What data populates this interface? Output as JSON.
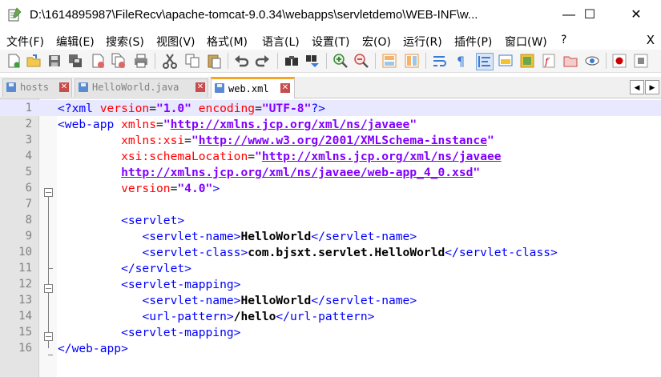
{
  "window": {
    "title": "D:\\1614895987\\FileRecv\\apache-tomcat-9.0.34\\webapps\\servletdemo\\WEB-INF\\w...",
    "minimize": "—",
    "maximize": "☐",
    "close": "✕"
  },
  "menu": {
    "items": [
      "文件(F)",
      "编辑(E)",
      "搜索(S)",
      "视图(V)",
      "格式(M)",
      "语言(L)",
      "设置(T)",
      "宏(O)",
      "运行(R)",
      "插件(P)",
      "窗口(W)",
      "?"
    ],
    "close": "X"
  },
  "toolbar": {
    "icons": [
      "new-file-icon",
      "open-file-icon",
      "save-icon",
      "save-all-icon",
      "close-icon",
      "close-all-icon",
      "print-icon",
      "cut-icon",
      "copy-icon",
      "paste-icon",
      "undo-icon",
      "redo-icon",
      "find-icon",
      "replace-icon",
      "zoom-in-icon",
      "zoom-out-icon",
      "sync-vertical-icon",
      "sync-horizontal-icon",
      "word-wrap-icon",
      "show-all-chars-icon",
      "indent-guide-icon",
      "lang-udl-icon",
      "doc-map-icon",
      "function-list-icon",
      "folder-workspace-icon",
      "monitor-icon",
      "record-macro-icon",
      "stop-macro-icon"
    ]
  },
  "tabs": [
    {
      "label": "hosts",
      "active": false
    },
    {
      "label": "HelloWorld.java",
      "active": false
    },
    {
      "label": "web.xml",
      "active": true
    }
  ],
  "tab_nav": {
    "left": "◀",
    "right": "▶"
  },
  "editor": {
    "lines": [
      {
        "n": "1",
        "tokens": [
          [
            "tag",
            "<?xml "
          ],
          [
            "attr",
            "version"
          ],
          [
            "plain",
            "="
          ],
          [
            "val",
            "\"1.0\""
          ],
          [
            "plain",
            " "
          ],
          [
            "attr",
            "encoding"
          ],
          [
            "plain",
            "="
          ],
          [
            "val",
            "\"UTF-8\""
          ],
          [
            "tag",
            "?>"
          ]
        ]
      },
      {
        "n": "2",
        "tokens": [
          [
            "tag",
            "<web-app "
          ],
          [
            "attr",
            "xmlns"
          ],
          [
            "plain",
            "="
          ],
          [
            "val",
            "\""
          ],
          [
            "url",
            "http://xmlns.jcp.org/xml/ns/javaee"
          ],
          [
            "val",
            "\""
          ]
        ]
      },
      {
        "n": "3",
        "tokens": [
          [
            "plain",
            "         "
          ],
          [
            "attr",
            "xmlns:xsi"
          ],
          [
            "plain",
            "="
          ],
          [
            "val",
            "\""
          ],
          [
            "url",
            "http://www.w3.org/2001/XMLSchema-instance"
          ],
          [
            "val",
            "\""
          ]
        ]
      },
      {
        "n": "4",
        "tokens": [
          [
            "plain",
            "         "
          ],
          [
            "attr",
            "xsi:schemaLocation"
          ],
          [
            "plain",
            "="
          ],
          [
            "val",
            "\""
          ],
          [
            "url",
            "http://xmlns.jcp.org/xml/ns/javaee"
          ]
        ]
      },
      {
        "n": "5",
        "tokens": [
          [
            "plain",
            "         "
          ],
          [
            "url",
            "http://xmlns.jcp.org/xml/ns/javaee/web-app_4_0.xsd"
          ],
          [
            "val",
            "\""
          ]
        ]
      },
      {
        "n": "6",
        "tokens": [
          [
            "plain",
            "         "
          ],
          [
            "attr",
            "version"
          ],
          [
            "plain",
            "="
          ],
          [
            "val",
            "\"4.0\""
          ],
          [
            "tag",
            ">"
          ]
        ]
      },
      {
        "n": "7",
        "tokens": []
      },
      {
        "n": "8",
        "tokens": [
          [
            "plain",
            "         "
          ],
          [
            "tag",
            "<servlet>"
          ]
        ]
      },
      {
        "n": "9",
        "tokens": [
          [
            "plain",
            "            "
          ],
          [
            "tag",
            "<servlet-name>"
          ],
          [
            "text",
            "HelloWorld"
          ],
          [
            "tag",
            "</servlet-name>"
          ]
        ]
      },
      {
        "n": "10",
        "tokens": [
          [
            "plain",
            "            "
          ],
          [
            "tag",
            "<servlet-class>"
          ],
          [
            "text",
            "com.bjsxt.servlet.HelloWorld"
          ],
          [
            "tag",
            "</servlet-class>"
          ]
        ]
      },
      {
        "n": "11",
        "tokens": [
          [
            "plain",
            "         "
          ],
          [
            "tag",
            "</servlet>"
          ]
        ]
      },
      {
        "n": "12",
        "tokens": [
          [
            "plain",
            "         "
          ],
          [
            "tag",
            "<servlet-mapping>"
          ]
        ]
      },
      {
        "n": "13",
        "tokens": [
          [
            "plain",
            "            "
          ],
          [
            "tag",
            "<servlet-name>"
          ],
          [
            "text",
            "HelloWorld"
          ],
          [
            "tag",
            "</servlet-name>"
          ]
        ]
      },
      {
        "n": "14",
        "tokens": [
          [
            "plain",
            "            "
          ],
          [
            "tag",
            "<url-pattern>"
          ],
          [
            "text",
            "/hello"
          ],
          [
            "tag",
            "</url-pattern>"
          ]
        ]
      },
      {
        "n": "15",
        "tokens": [
          [
            "plain",
            "         "
          ],
          [
            "tag",
            "<servlet-mapping>"
          ]
        ]
      },
      {
        "n": "16",
        "tokens": [
          [
            "tag",
            "</web-app>"
          ]
        ]
      }
    ],
    "current_line": "1"
  }
}
